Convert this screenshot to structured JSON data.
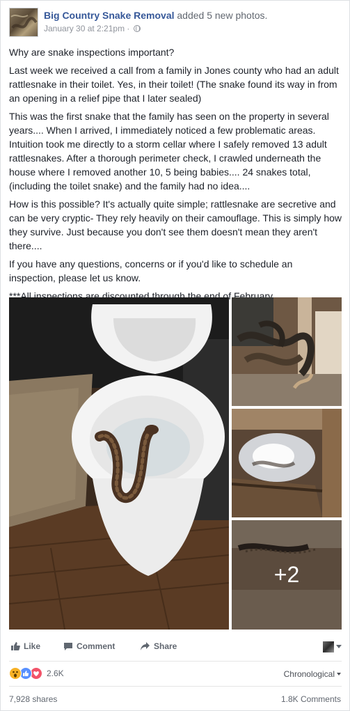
{
  "post": {
    "page_name": "Big Country Snake Removal",
    "action_text": "added 5 new photos.",
    "timestamp": "January 30 at 2:21pm",
    "separator": "·",
    "paragraphs": [
      "Why are snake inspections important?",
      "Last week we received a call from a family in Jones county who had an adult rattlesnake in their toilet. Yes, in their toilet! (The snake found its way in from an opening in a relief pipe that I later sealed)",
      "This was the first snake that the family has seen on the property in several years.... When I arrived, I immediately noticed a few problematic areas. Intuition took me directly to a storm cellar where I safely removed 13 adult rattlesnakes. After a thorough perimeter check, I crawled underneath the house where I removed another 10, 5 being babies.... 24 snakes total, (including the toilet snake) and the family had no idea....",
      "How is this possible? It's actually quite simple; rattlesnake are secretive and can be very cryptic- They rely heavily on their camouflage. This is simply how they survive. Just because you don't see them doesn't mean they aren't there....",
      "If you have any questions, concerns or if you'd like to schedule an inspection, please let us know.",
      "***All inspections are discounted through the end of February."
    ],
    "more_photos_label": "+2"
  },
  "actions": {
    "like": "Like",
    "comment": "Comment",
    "share": "Share"
  },
  "stats": {
    "reaction_count": "2.6K",
    "sort_label": "Chronological",
    "shares": "7,928 shares",
    "comments": "1.8K Comments"
  },
  "icons": {
    "reactions": [
      "wow-icon",
      "like-icon",
      "love-icon"
    ],
    "actions": [
      "thumbs-up-icon",
      "comment-icon",
      "share-arrow-icon",
      "globe-icon"
    ]
  },
  "colors": {
    "link": "#365899",
    "meta": "#90949c",
    "action": "#616770",
    "wow": "#f7b125",
    "like": "#5890ff",
    "love": "#f25268"
  }
}
